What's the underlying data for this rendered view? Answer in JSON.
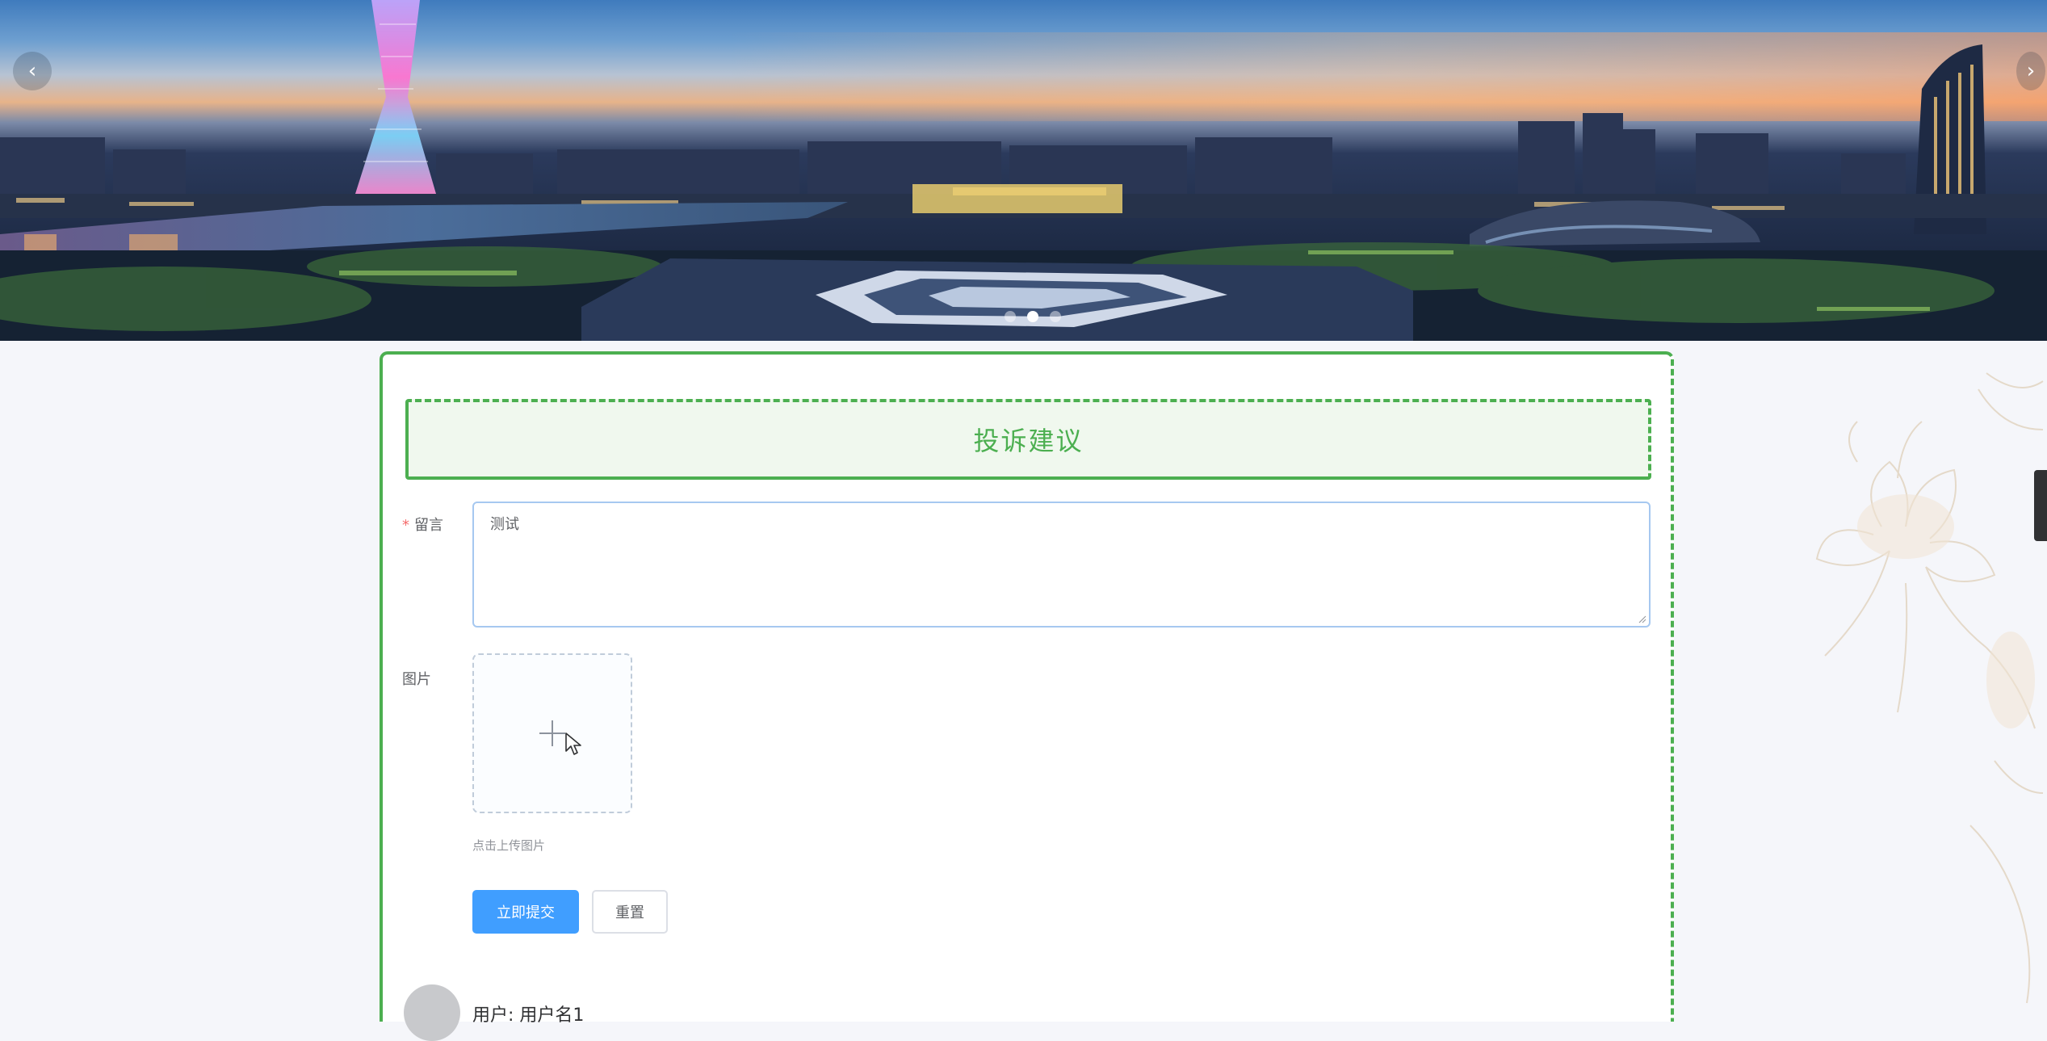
{
  "banner": {
    "prev_arrow": "‹",
    "next_arrow": "›",
    "indicator_count": 3,
    "active_indicator": 1
  },
  "form": {
    "title": "投诉建议",
    "message_label": "留言",
    "message_required_mark": "*",
    "message_value": "测试",
    "image_label": "图片",
    "upload_tip": "点击上传图片",
    "submit_label": "立即提交",
    "reset_label": "重置"
  },
  "comment": {
    "user_prefix": "用户:",
    "user_name": "用户名1"
  },
  "colors": {
    "accent_green": "#4caf50",
    "primary_blue": "#409eff",
    "required_red": "#f56c6c"
  },
  "icons": {
    "upload": "plus-icon",
    "prev": "chevron-left-icon",
    "next": "chevron-right-icon"
  }
}
